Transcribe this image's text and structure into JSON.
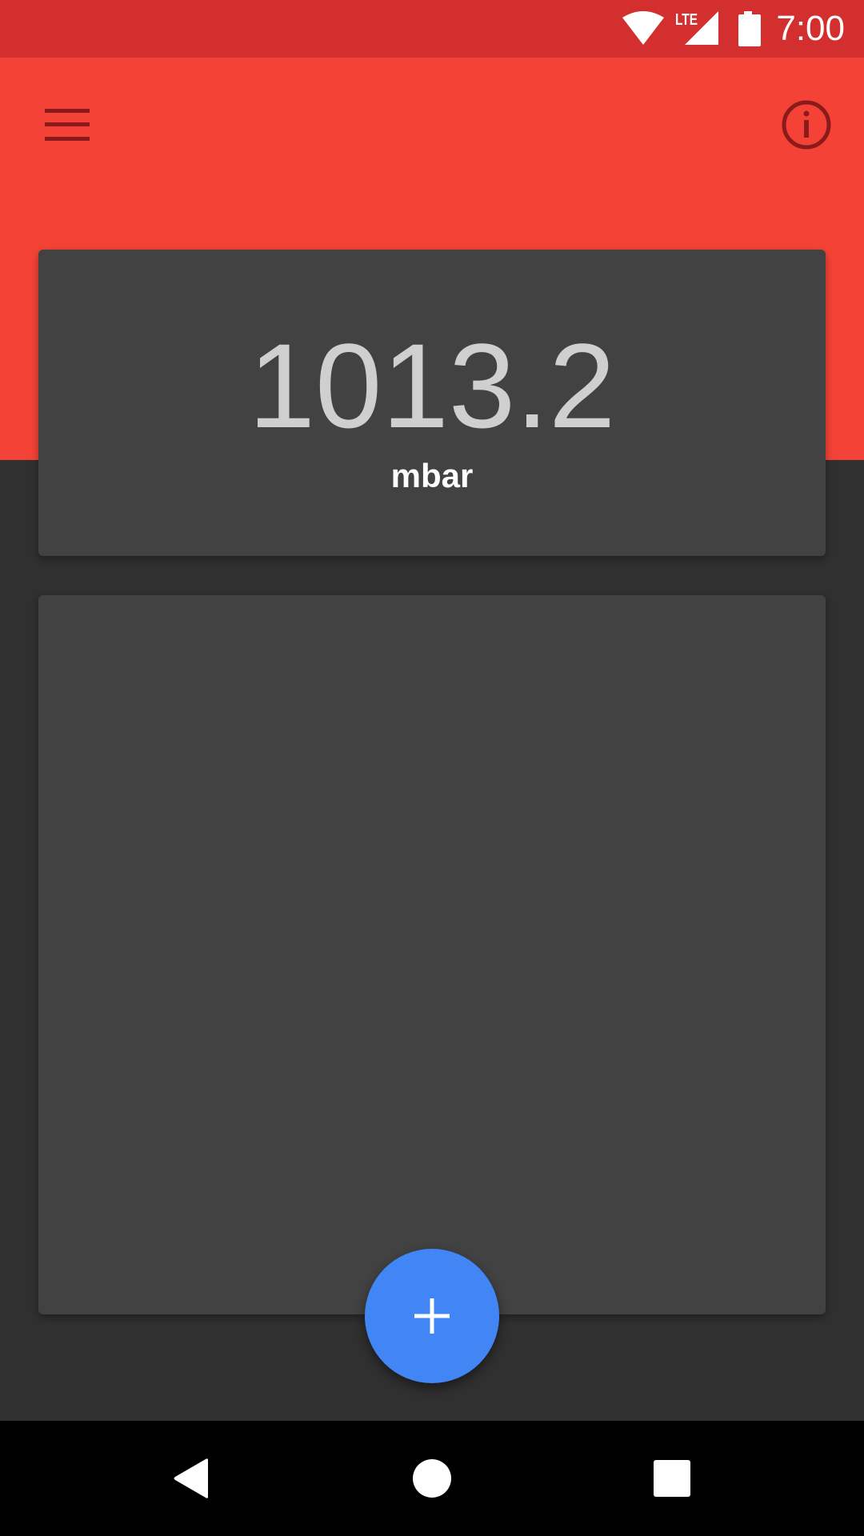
{
  "status_bar": {
    "time": "7:00",
    "network_label": "LTE",
    "icons": [
      "wifi-icon",
      "lte-signal-icon",
      "battery-icon"
    ],
    "color": "#d32f2f"
  },
  "app_bar": {
    "color": "#f44336",
    "menu_icon": "hamburger-menu-icon",
    "info_icon": "info-icon"
  },
  "reading": {
    "value": "1013.2",
    "unit": "mbar"
  },
  "fab": {
    "icon": "plus-icon",
    "color": "#4285f4"
  },
  "nav_bar": {
    "icons": [
      "back-icon",
      "home-icon",
      "recents-icon"
    ]
  }
}
